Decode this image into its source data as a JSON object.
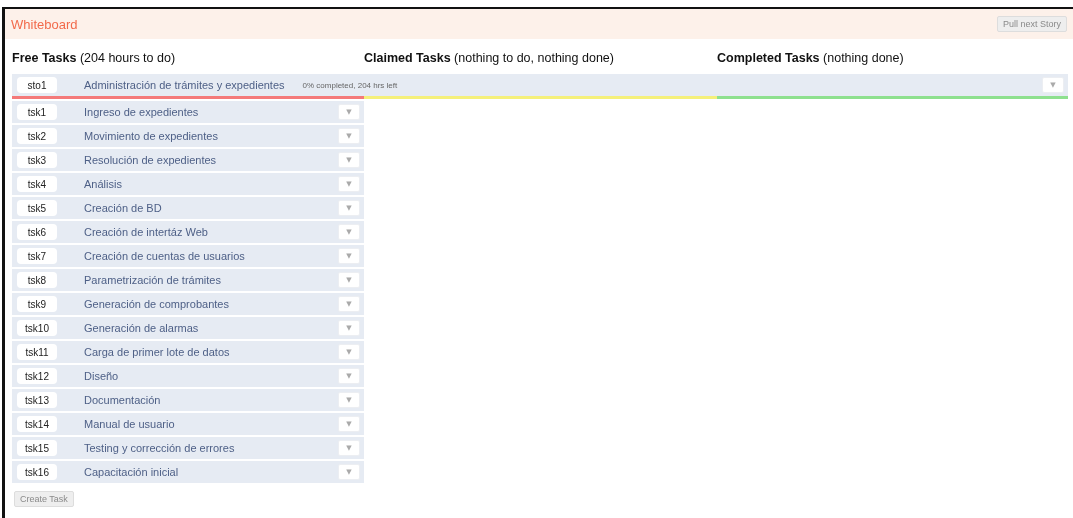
{
  "header": {
    "title": "Whiteboard",
    "pull_button": {
      "label": "Pull next Story",
      "disabled": true
    }
  },
  "columns": [
    {
      "title": "Free Tasks",
      "summary": "(204 hours to do)",
      "color": "#f47a7a"
    },
    {
      "title": "Claimed Tasks",
      "summary": "(nothing to do, nothing done)",
      "color": "#f5f07a"
    },
    {
      "title": "Completed Tasks",
      "summary": "(nothing done)",
      "color": "#8ee08e"
    }
  ],
  "story": {
    "id": "sto1",
    "name": "Administración de trámites y expedientes",
    "summary": "0% completed, 204 hrs left",
    "menu": "▼"
  },
  "tasks": [
    {
      "id": "tsk1",
      "name": "Ingreso de expedientes",
      "menu": "▼"
    },
    {
      "id": "tsk2",
      "name": "Movimiento de expedientes",
      "menu": "▼"
    },
    {
      "id": "tsk3",
      "name": "Resolución de expedientes",
      "menu": "▼"
    },
    {
      "id": "tsk4",
      "name": "Análisis",
      "menu": "▼"
    },
    {
      "id": "tsk5",
      "name": "Creación de BD",
      "menu": "▼"
    },
    {
      "id": "tsk6",
      "name": "Creación de intertáz Web",
      "menu": "▼"
    },
    {
      "id": "tsk7",
      "name": "Creación de cuentas de usuarios",
      "menu": "▼"
    },
    {
      "id": "tsk8",
      "name": "Parametrización de trámites",
      "menu": "▼"
    },
    {
      "id": "tsk9",
      "name": "Generación de comprobantes",
      "menu": "▼"
    },
    {
      "id": "tsk10",
      "name": "Generación de alarmas",
      "menu": "▼"
    },
    {
      "id": "tsk11",
      "name": "Carga de primer lote de datos",
      "menu": "▼"
    },
    {
      "id": "tsk12",
      "name": "Diseño",
      "menu": "▼"
    },
    {
      "id": "tsk13",
      "name": "Documentación",
      "menu": "▼"
    },
    {
      "id": "tsk14",
      "name": "Manual de usuario",
      "menu": "▼"
    },
    {
      "id": "tsk15",
      "name": "Testing y corrección de errores",
      "menu": "▼"
    },
    {
      "id": "tsk16",
      "name": "Capacitación inicial",
      "menu": "▼"
    }
  ],
  "create_button": {
    "label": "Create Task",
    "disabled": true
  }
}
